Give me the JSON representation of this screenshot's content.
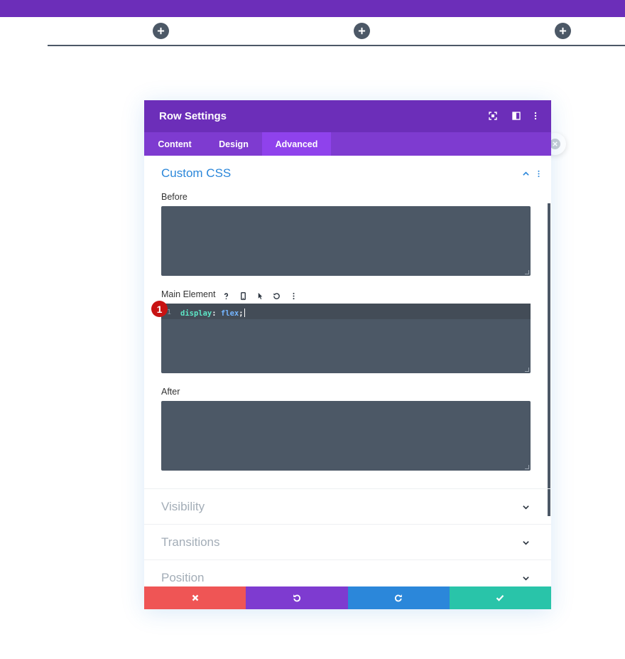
{
  "colors": {
    "topbar": "#6c2eb9",
    "modal_header": "#6c2eb9",
    "tab_bar": "#7e3bd0",
    "tab_active": "#8f42ec",
    "accent_blue": "#2b87da",
    "editor_bg": "#4c5866",
    "cancel": "#ef5555",
    "undo": "#7e3bd0",
    "redo": "#2b87da",
    "save": "#29c4a9",
    "badge": "#c81313"
  },
  "canvas": {
    "plus_icons": [
      "plus-icon",
      "plus-icon",
      "plus-icon"
    ]
  },
  "modal": {
    "title": "Row Settings",
    "header_icons": [
      "fullscreen-icon",
      "split-view-icon",
      "more-vertical-icon"
    ],
    "tabs": [
      {
        "label": "Content",
        "active": false
      },
      {
        "label": "Design",
        "active": false
      },
      {
        "label": "Advanced",
        "active": true
      }
    ],
    "section": {
      "title": "Custom CSS",
      "expanded": true,
      "fields": {
        "before": {
          "label": "Before",
          "value": ""
        },
        "main": {
          "label": "Main Element",
          "tool_icons": [
            "help-icon",
            "mobile-icon",
            "cursor-icon",
            "reset-icon",
            "more-vertical-icon"
          ],
          "line_number": "1",
          "code_property": "display",
          "code_colon": ":",
          "code_value": "flex",
          "code_semicolon": ";"
        },
        "after": {
          "label": "After",
          "value": ""
        }
      }
    },
    "collapsed_sections": [
      "Visibility",
      "Transitions",
      "Position"
    ],
    "footer": {
      "buttons": [
        "cancel-icon",
        "undo-icon",
        "redo-icon",
        "save-check-icon"
      ]
    }
  },
  "annotation_badge": "1"
}
